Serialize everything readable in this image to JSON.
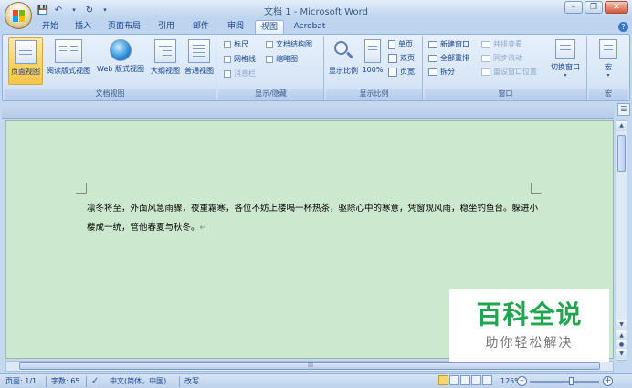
{
  "window": {
    "title": "文档 1 - Microsoft Word",
    "controls": [
      "minimize",
      "restore",
      "close"
    ]
  },
  "quick_access": [
    "save",
    "undo",
    "redo",
    "customize"
  ],
  "tabs": [
    {
      "label": "开始"
    },
    {
      "label": "插入"
    },
    {
      "label": "页面布局"
    },
    {
      "label": "引用"
    },
    {
      "label": "邮件"
    },
    {
      "label": "审阅"
    },
    {
      "label": "视图",
      "active": true
    },
    {
      "label": "Acrobat"
    }
  ],
  "ribbon": {
    "doc_views": {
      "label": "文档视图",
      "buttons": [
        "页面视图",
        "阅读版式视图",
        "Web 版式视图",
        "大纲视图",
        "普通视图"
      ]
    },
    "show_hide": {
      "label": "显示/隐藏",
      "items": [
        "标尺",
        "网格线",
        "消息栏",
        "文档结构图",
        "缩略图"
      ]
    },
    "zoom": {
      "label": "显示比例",
      "buttons": [
        "显示比例",
        "100%"
      ],
      "small": [
        "单页",
        "双页",
        "页宽"
      ]
    },
    "window": {
      "label": "窗口",
      "items": [
        "新建窗口",
        "全部重排",
        "拆分",
        "并排查看",
        "同步滚动",
        "重设窗口位置",
        "切换窗口"
      ]
    },
    "macros": {
      "label": "宏",
      "button": "宏"
    }
  },
  "document": {
    "text": "凛冬将至，外面风急雨骤，夜重霜寒，各位不妨上楼喝一杯热茶，驱除心中的寒意，凭窗观风雨，稳坐钓鱼台。躲进小楼成一统，管他春夏与秋冬。"
  },
  "statusbar": {
    "page": "页面: 1/1",
    "words": "字数: 65",
    "language": "中文(简体，中国)",
    "mode": "改写",
    "zoom": "125%"
  },
  "watermark": {
    "title": "百科全说",
    "subtitle": "助你轻松解决"
  }
}
